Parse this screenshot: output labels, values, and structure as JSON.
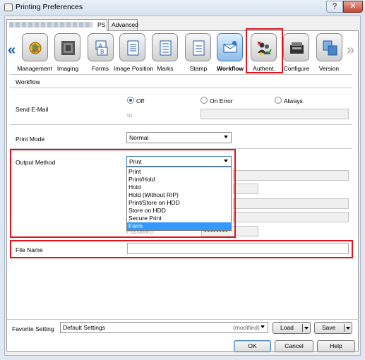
{
  "window": {
    "title": "Printing Preferences",
    "close_glyph": "✕",
    "help_glyph": "?"
  },
  "tabs": [
    {
      "label": "PS"
    },
    {
      "label": "Advanced"
    }
  ],
  "toolbar": {
    "items": [
      {
        "label": "Management",
        "icon": "management-icon"
      },
      {
        "label": "Imaging",
        "icon": "imaging-icon"
      },
      {
        "label": "Forms",
        "icon": "forms-icon"
      },
      {
        "label": "Image Position",
        "icon": "image-position-icon"
      },
      {
        "label": "Marks",
        "icon": "marks-icon"
      },
      {
        "label": "Stamp",
        "icon": "stamp-icon"
      },
      {
        "label": "Workflow",
        "icon": "workflow-icon"
      },
      {
        "label": "Authent.",
        "icon": "authentication-icon"
      },
      {
        "label": "Configure",
        "icon": "configure-icon"
      },
      {
        "label": "Version",
        "icon": "version-icon"
      }
    ],
    "left_arrow": "«",
    "right_arrow": "»"
  },
  "workflow": {
    "section_title": "Workflow",
    "send_email": {
      "label": "Send E-Mail",
      "options": [
        "Off",
        "On Error",
        "Always"
      ],
      "selected": "Off",
      "to_label": "to"
    },
    "print_mode": {
      "label": "Print Mode",
      "value": "Normal"
    },
    "output_method": {
      "label": "Output Method",
      "value": "Print",
      "options": [
        "Print",
        "Print/Hold",
        "Hold",
        "Hold (Without RIP)",
        "Print/Store on HDD",
        "Store on HDD",
        "Secure Print",
        "Form"
      ],
      "highlighted": "Form"
    },
    "password_label": "Password",
    "password_value": "●●●●●●●●",
    "file_name": {
      "label": "File Name",
      "value": ""
    }
  },
  "footer": {
    "favorite_label": "Favorite Setting",
    "favorite_value": "Default Settings",
    "favorite_state": "(modified)",
    "load_label": "Load",
    "save_label": "Save",
    "ok_label": "OK",
    "cancel_label": "Cancel",
    "help_label": "Help"
  },
  "colors": {
    "highlight_box": "#e0141c",
    "selection": "#3399ff",
    "accent": "#0b5ea8"
  }
}
